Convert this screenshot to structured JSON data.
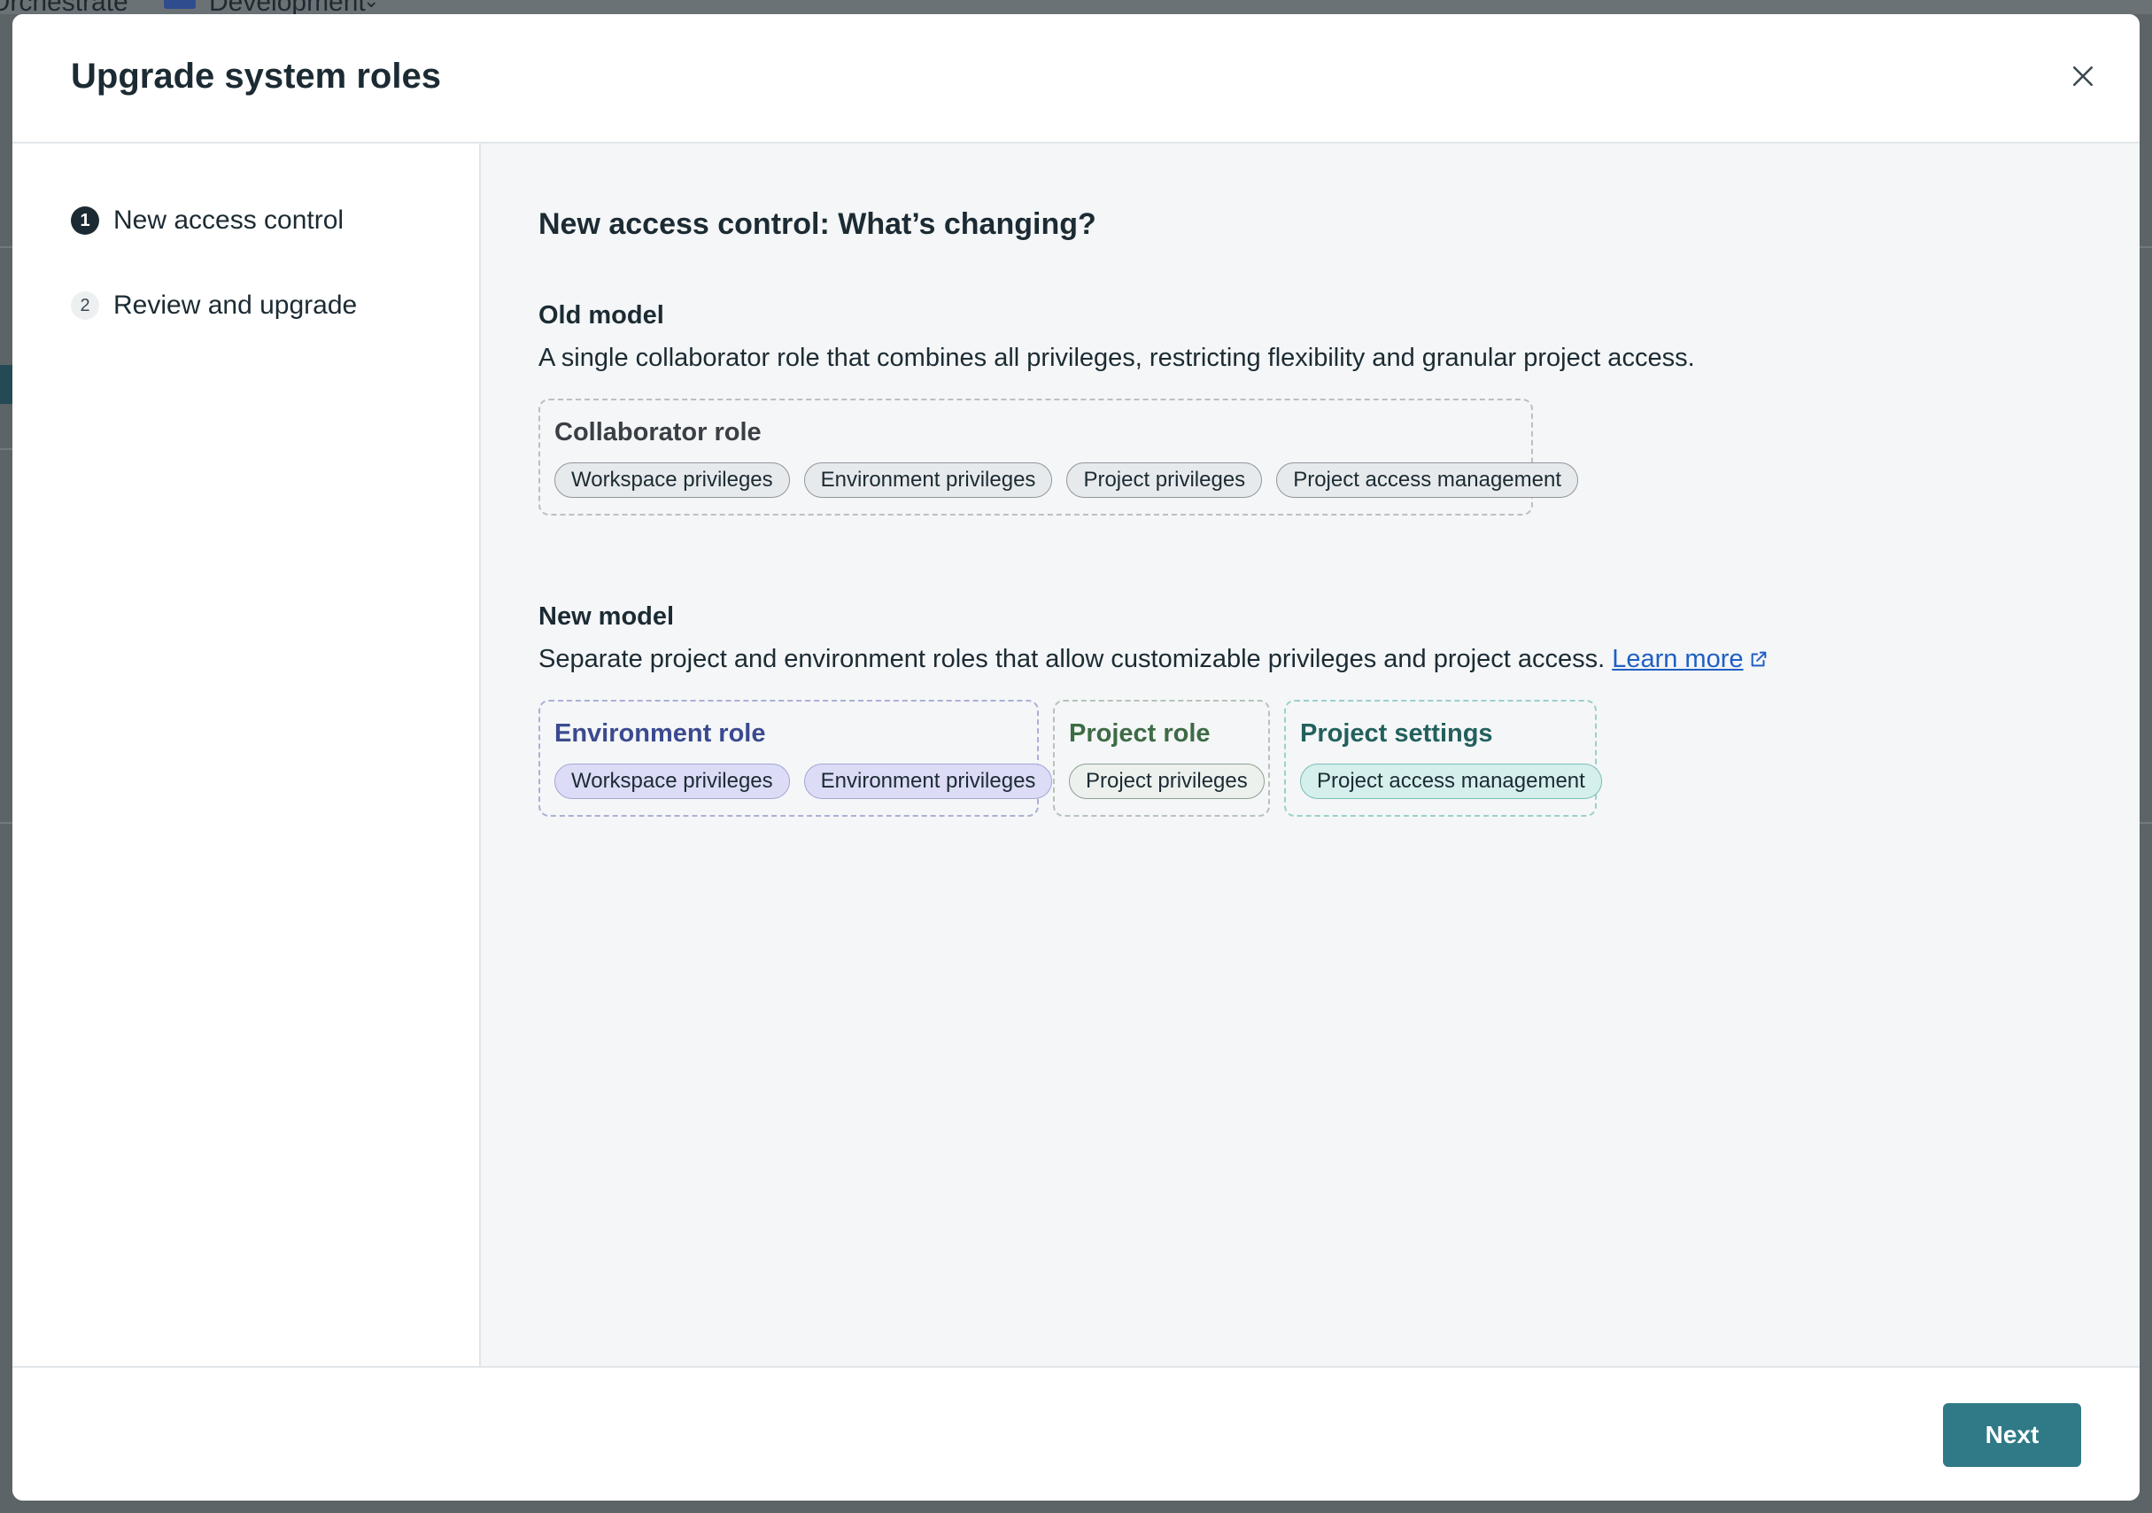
{
  "background": {
    "app_name": "Orchestrate",
    "environment": "Development"
  },
  "modal": {
    "title": "Upgrade system roles",
    "close_label": "Close"
  },
  "steps": [
    {
      "number": "1",
      "label": "New access control",
      "state": "active"
    },
    {
      "number": "2",
      "label": "Review and upgrade",
      "state": "inactive"
    }
  ],
  "content": {
    "title": "New access control: What’s changing?",
    "old_model": {
      "heading": "Old model",
      "description": "A single collaborator role that combines all privileges, restricting flexibility and granular project access.",
      "role": {
        "title": "Collaborator role",
        "chips": [
          "Workspace privileges",
          "Environment privileges",
          "Project privileges",
          "Project access management"
        ]
      }
    },
    "new_model": {
      "heading": "New model",
      "description": "Separate project and environment roles that allow customizable privileges and project access.",
      "learn_more": "Learn more",
      "environment_role": {
        "title": "Environment role",
        "chips": [
          "Workspace privileges",
          "Environment privileges"
        ]
      },
      "project_role": {
        "title": "Project role",
        "chips": [
          "Project privileges"
        ]
      },
      "project_settings": {
        "title": "Project settings",
        "chips": [
          "Project access management"
        ]
      }
    }
  },
  "footer": {
    "next_label": "Next"
  },
  "colors": {
    "primary_button": "#2f7a86",
    "env_role_title": "#3b4a8f",
    "project_role_title": "#3d6b45",
    "project_settings_title": "#22605d",
    "collaborator_title": "#3a3f45",
    "link": "#1f5fc4"
  },
  "icons": {
    "close": "close-icon",
    "external_link": "external-link-icon"
  }
}
